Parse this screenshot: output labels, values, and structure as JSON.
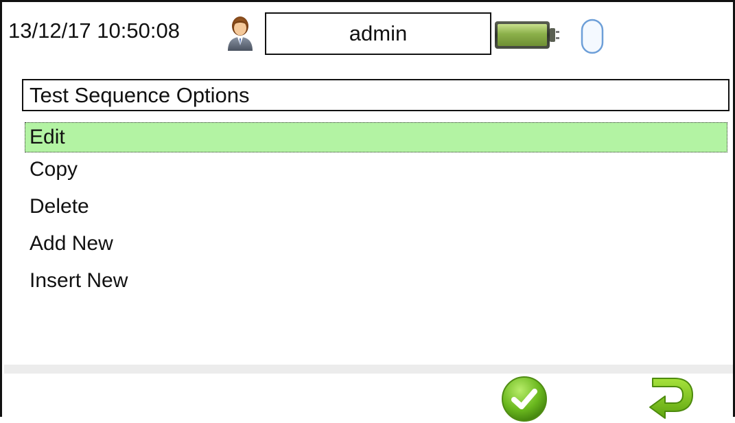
{
  "status_bar": {
    "datetime": "13/12/17 10:50:08",
    "user_icon": "user-icon",
    "username": "admin",
    "battery_icon": "battery-full-icon",
    "usb_icon": "usb-icon"
  },
  "title": "Test Sequence Options",
  "menu": {
    "selected_index": 0,
    "items": [
      {
        "label": "Edit"
      },
      {
        "label": "Copy"
      },
      {
        "label": "Delete"
      },
      {
        "label": "Add New"
      },
      {
        "label": "Insert New"
      }
    ]
  },
  "footer": {
    "ok_icon": "check-icon",
    "back_icon": "return-arrow-icon"
  },
  "colors": {
    "selection": "#b3f3a3",
    "ok_green": "#6ab81e",
    "back_green": "#79c21a",
    "battery_green": "#8bb04a"
  }
}
